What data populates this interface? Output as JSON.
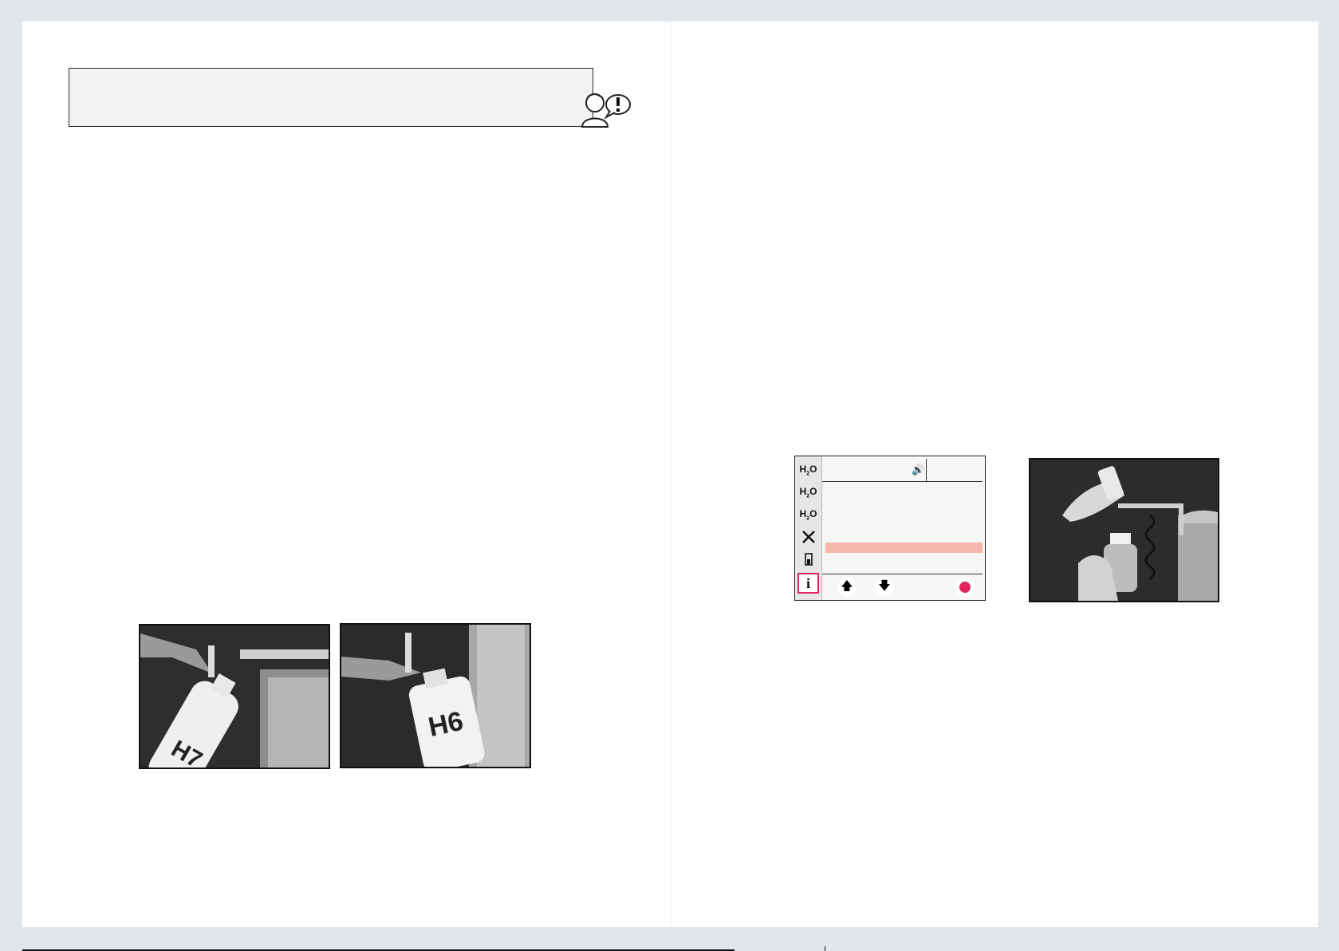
{
  "icons": {
    "note": "attention-person-icon",
    "display_sidebar": [
      "h2o-icon",
      "h2o-icon",
      "h2o-icon",
      "tools-icon",
      "cartridge-icon",
      "info-icon"
    ],
    "speaker": "speaker-icon",
    "arrow_up": "arrow-up-icon",
    "arrow_down": "arrow-down-icon",
    "stop": "stop-icon"
  },
  "display": {
    "side_labels": [
      "H2O",
      "H2O",
      "H2O",
      "",
      "",
      "i"
    ],
    "accent_color": "#e0245e",
    "highlight_color": "#f4b7ac"
  },
  "photos": {
    "left_label": "H7",
    "right_label": "H6"
  }
}
